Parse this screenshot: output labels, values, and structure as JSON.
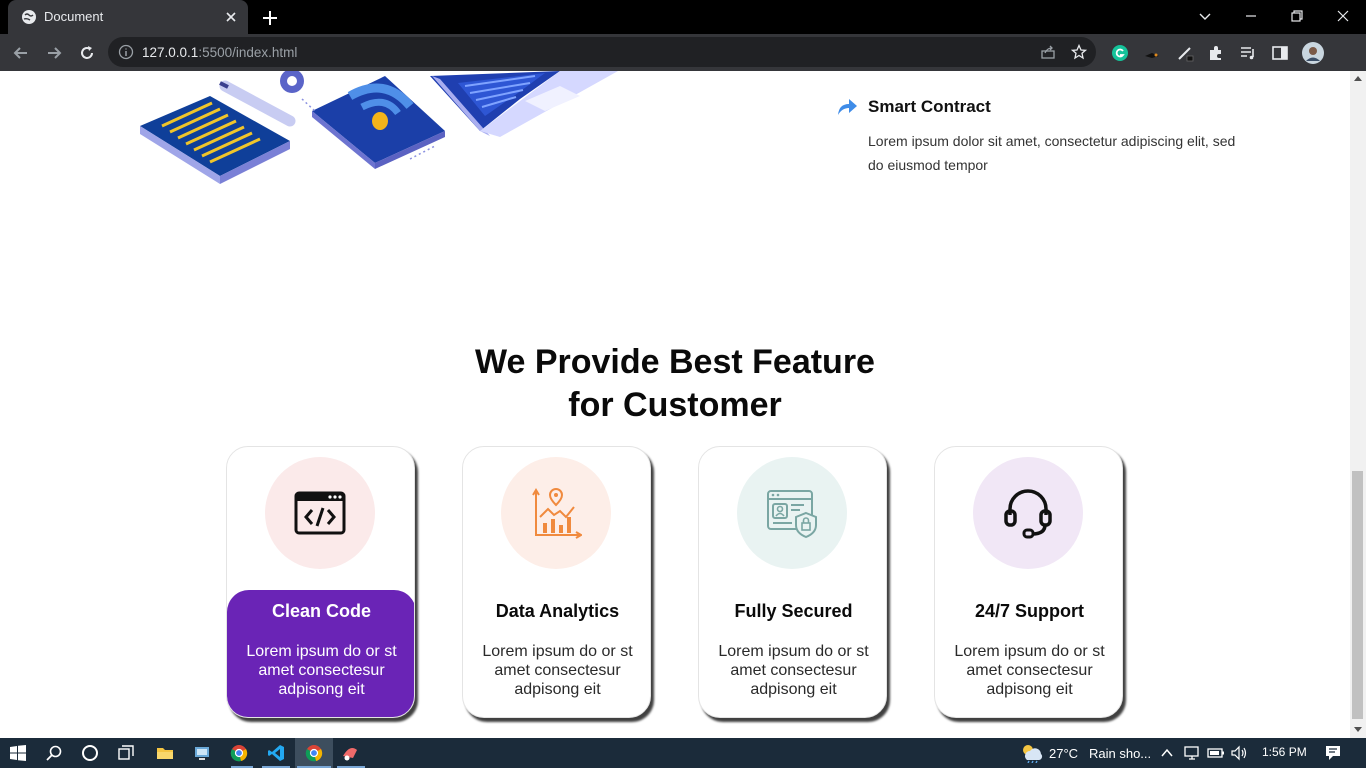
{
  "browser": {
    "tab_title": "Document",
    "url_host": "127.0.0.1",
    "url_rest": ":5500/index.html"
  },
  "smart_contract": {
    "title": "Smart Contract",
    "text": "Lorem ipsum dolor sit amet, consectetur adipiscing elit, sed do eiusmod tempor"
  },
  "features": {
    "title_line1": "We Provide Best Feature",
    "title_line2": "for Customer",
    "cards": [
      {
        "title": "Clean Code",
        "text": "Lorem ipsum do or st amet consectesur adpisong eit",
        "circle_color": "#fbeaea",
        "icon": "code-window-icon",
        "active": true
      },
      {
        "title": "Data Analytics",
        "text": "Lorem ipsum do or st amet consectesur adpisong eit",
        "circle_color": "#fdeee8",
        "icon": "analytics-chart-icon",
        "active": false
      },
      {
        "title": "Fully Secured",
        "text": "Lorem ipsum do or st amet consectesur adpisong eit",
        "circle_color": "#e9f3f2",
        "icon": "secure-profile-icon",
        "active": false
      },
      {
        "title": "24/7 Support",
        "text": "Lorem ipsum do or st amet consectesur adpisong eit",
        "circle_color": "#f1e7f6",
        "icon": "headset-icon",
        "active": false
      }
    ]
  },
  "colors": {
    "accent_purple": "#6a24b6",
    "arrow_blue": "#3f8ce8",
    "analytics_orange": "#f08a3e",
    "secure_teal": "#7aa6a3"
  },
  "taskbar": {
    "weather_temp": "27°C",
    "weather_desc": "Rain sho...",
    "time": "1:56 PM"
  }
}
